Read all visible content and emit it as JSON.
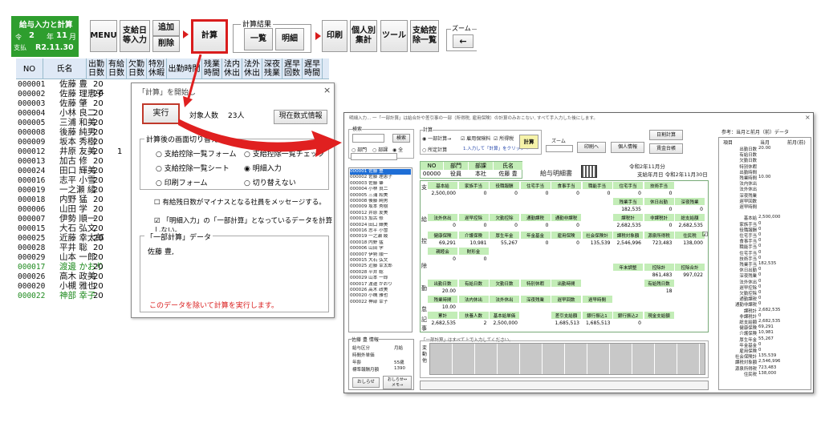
{
  "left_panel": {
    "title": "給与入力と計算",
    "era": "令",
    "year_num": "2",
    "year_label": "年",
    "month_num": "11",
    "month_label": "月",
    "pay_label": "支払",
    "pay_date": "R2.11.30"
  },
  "toolbar": {
    "menu": "MENU",
    "payday": "支給日\n等入力",
    "add": "追加",
    "delete": "削除",
    "calc": "計算",
    "result_group": "計算結果",
    "list": "一覧",
    "detail": "明細",
    "print": "印刷",
    "personal_total": "個人別\n集計",
    "tools": "ツール",
    "deduct_list": "支給控\n除一覧",
    "zoom": "ズーム",
    "zoom_arrow": "←"
  },
  "columns": [
    "NO",
    "氏名",
    "出勤\n日数",
    "有給\n日数",
    "欠勤\n日数",
    "特別\n休暇",
    "出勤時間",
    "残業\n時間",
    "法内\n休出",
    "法外\n休出",
    "深夜\n残業",
    "遅早\n回数",
    "遅早\n時間"
  ],
  "employees": [
    {
      "no": "000001",
      "name": "佐藤 豊",
      "days": "20",
      "paid": ""
    },
    {
      "no": "000002",
      "name": "佐藤 理恵子",
      "days": "20",
      "paid": ""
    },
    {
      "no": "000003",
      "name": "佐藤 肇",
      "days": "20",
      "paid": ""
    },
    {
      "no": "000004",
      "name": "小林 良二",
      "days": "20",
      "paid": ""
    },
    {
      "no": "000005",
      "name": "三浦 和美",
      "days": "20",
      "paid": ""
    },
    {
      "no": "000008",
      "name": "後藤 純男",
      "days": "20",
      "paid": ""
    },
    {
      "no": "000009",
      "name": "坂本 秀樹",
      "days": "20",
      "paid": ""
    },
    {
      "no": "000012",
      "name": "井原 友美",
      "days": "20",
      "paid": "1"
    },
    {
      "no": "000013",
      "name": "加古 修",
      "days": "20",
      "paid": ""
    },
    {
      "no": "000024",
      "name": "田口 輝美",
      "days": "20",
      "paid": ""
    },
    {
      "no": "000016",
      "name": "志平 小雪",
      "days": "20",
      "paid": ""
    },
    {
      "no": "000019",
      "name": "一之瀬 綾",
      "days": "20",
      "paid": ""
    },
    {
      "no": "000018",
      "name": "内野 猛",
      "days": "20",
      "paid": ""
    },
    {
      "no": "000006",
      "name": "山田 学",
      "days": "20",
      "paid": ""
    },
    {
      "no": "000007",
      "name": "伊勢 順一",
      "days": "20",
      "paid": ""
    },
    {
      "no": "000015",
      "name": "大石 弘文",
      "days": "20",
      "paid": ""
    },
    {
      "no": "000025",
      "name": "近藤 幸太郎",
      "days": "20",
      "paid": ""
    },
    {
      "no": "000028",
      "name": "平井 聡",
      "days": "20",
      "paid": ""
    },
    {
      "no": "000029",
      "name": "山本 一郎",
      "days": "20",
      "paid": ""
    },
    {
      "no": "000017",
      "name": "渡邊 かおり",
      "days": "20",
      "paid": ""
    },
    {
      "no": "000026",
      "name": "高木 政美",
      "days": "20",
      "paid": ""
    },
    {
      "no": "000020",
      "name": "小槻 雅也",
      "days": "20",
      "paid": ""
    },
    {
      "no": "000022",
      "name": "神部 幸子",
      "days": "20",
      "paid": ""
    }
  ],
  "calc_dialog": {
    "title": "「計算」を開始し",
    "close": "×",
    "run": "実行",
    "target_label": "対象人数",
    "target_count": "23人",
    "formula_info": "現在数式情報",
    "switch_group": "計算後の画面切り替え",
    "opt1": "支給控除一覧フォーム",
    "opt2": "支給控除一覧チェック",
    "opt3": "支給控除一覧シート",
    "opt4": "明細入力",
    "opt5": "印刷フォーム",
    "opt6": "切り替えない",
    "check1": "有給残日数がマイナスとなる社員をメッセージする。",
    "check2": "「明細入力」の「一部計算」となっているデータを計算しない。",
    "partial_group": "「一部計算」データ",
    "partial_name": "佐藤 豊,",
    "warning": "このデータを除いて計算を実行します。"
  },
  "detail_window": {
    "title": "明細入力... 一「一部計算」は給合計や差引事の一部（所得税, 雇用保険）の計算のみおこない, すべて手入力した後にします。",
    "search_group": "検索",
    "search_btn": "検索",
    "radio_dept": "部門",
    "radio_dept2": "部課",
    "radio_all": "全",
    "calc_group": "計算",
    "calc_partial": "一部計算→",
    "calc_emp": "雇用保険料",
    "calc_tax": "所得税",
    "calc_fixed": "所定計算",
    "calc_hint": "1.入力して「計算」をクリック→",
    "calc_btn": "計算",
    "zoom": "ズーム",
    "print": "印刷へ",
    "personal": "個人情報",
    "daily_calc": "日割計算",
    "wage_ledger": "賃金台帳",
    "header_no": "NO",
    "header_dept": "部門",
    "header_pos": "部課",
    "header_name": "氏名",
    "emp_no": "00000",
    "emp_pos": "役員",
    "emp_dept": "本社",
    "emp_name": "佐藤 豊",
    "slip": "給与明細書",
    "period": "令和2年11月分",
    "pay_date": "支給年月日 令和2年11月30日",
    "list": [
      "000001 佐藤 豊",
      "000002 佐藤 理恵子",
      "000003 佐藤 肇",
      "000004 小林 良二",
      "000005 三浦 和美",
      "000008 後藤 純男",
      "000009 坂本 秀樹",
      "000012 井原 友美",
      "000013 加古 修",
      "000024 田口 輝美",
      "000016 志平 小雪",
      "000019 一之瀬 綾",
      "000018 内野 猛",
      "000006 山田 学",
      "000007 伊勢 順一",
      "000015 大石 弘文",
      "000025 近藤 幸太郎",
      "000028 平井 聡",
      "000029 山本 一郎",
      "000017 渡邊 かおり",
      "000026 高木 政美",
      "000020 小槻 雅也",
      "000022 神部 幸子"
    ],
    "pay_h1": [
      "基本給",
      "家族手当",
      "役職報酬",
      "住宅手当",
      "食事手当",
      "職能手当",
      "住宅手当",
      "技術手当"
    ],
    "pay_v1": [
      "2,500,000",
      "0",
      "0",
      "0",
      "0",
      "0",
      "0",
      "0"
    ],
    "pay_h2": [
      "",
      "",
      "",
      "",
      "",
      "",
      "残業手当",
      "休日出勤",
      "深夜残業"
    ],
    "pay_v2": [
      "",
      "",
      "",
      "",
      "",
      "",
      "182,535",
      "0",
      "0"
    ],
    "pay_h3": [
      "法外休出",
      "遅早控除",
      "欠勤控除",
      "通勤課税",
      "通勤非課税",
      "",
      "課税計",
      "非課税計",
      "総支給額"
    ],
    "pay_v3": [
      "0",
      "0",
      "0",
      "0",
      "0",
      "",
      "2,682,535",
      "0",
      "2,682,535"
    ],
    "ded_h1": [
      "健康保険",
      "介護保険",
      "厚生年金",
      "年金基金",
      "雇用保険",
      "社会保険計",
      "課税対象額",
      "源泉所得税",
      "住民税"
    ],
    "ded_v1": [
      "69,291",
      "10,981",
      "55,267",
      "0",
      "0",
      "135,539",
      "2,546,996",
      "723,483",
      "138,000"
    ],
    "ded_h2": [
      "親睦会",
      "財形金"
    ],
    "ded_v2": [
      "0",
      "0"
    ],
    "ded_h3": [
      "年末調整",
      "控除計",
      "控除合計"
    ],
    "ded_v3": [
      "",
      "861,483",
      "997,022"
    ],
    "att_h1": [
      "出勤日数",
      "有給日数",
      "欠勤日数",
      "特別休暇",
      "出勤時間",
      "",
      "",
      "有給残日数"
    ],
    "att_v1": [
      "20.00",
      "",
      "",
      "",
      "",
      "",
      "",
      "18"
    ],
    "att_h2": [
      "残業時間",
      "法内休出",
      "法外休出",
      "深夜残業",
      "遅早回数",
      "遅早時間"
    ],
    "att_v2": [
      "10.00"
    ],
    "sum_h": [
      "累計",
      "扶養人数",
      "基本給単価",
      "",
      "差引支給額",
      "銀行振込1",
      "銀行振込2",
      "現金支給額"
    ],
    "sum_v": [
      "2,682,535",
      "2",
      "2,500,000",
      "",
      "1,685,513",
      "1,685,513",
      "0",
      ""
    ],
    "side_pay": "支",
    "side_pay2": "給",
    "side_ded": "控",
    "side_ded2": "除",
    "side_att": "勤",
    "side_att2": "怠",
    "side_rec": "記",
    "side_rec2": "事",
    "emp_info_title": "佐藤 豊 情報",
    "emp_info": [
      [
        "給与区分",
        "月給"
      ],
      [
        "時間外単価",
        ""
      ],
      [
        "年齢",
        "55歳"
      ],
      [
        "標準報酬月額",
        "1390"
      ]
    ],
    "close_btn": "おしらせ",
    "memo_btn": "おしらせ↔\nメモ→",
    "partial_note": "「一部計算」はすべて上で入力してください。",
    "change_label": "変\n動\n他",
    "ref_title": "参考：当月と前月（前）データ",
    "ref_head": [
      "項目",
      "当月",
      "前月(前)"
    ],
    "ref_rows": [
      [
        "出勤日数",
        "20.00"
      ],
      [
        "有給日数",
        ""
      ],
      [
        "欠勤日数",
        ""
      ],
      [
        "特別休暇",
        ""
      ],
      [
        "出勤時間",
        ""
      ],
      [
        "残業時間",
        "10.00"
      ],
      [
        "法内休出",
        ""
      ],
      [
        "法外休出",
        ""
      ],
      [
        "深夜残業",
        ""
      ],
      [
        "遅早回数",
        ""
      ],
      [
        "遅早時間",
        ""
      ],
      [
        "",
        ""
      ],
      [
        "基本給",
        "2,500,000"
      ],
      [
        "家族手当",
        "0"
      ],
      [
        "役職報酬",
        "0"
      ],
      [
        "住宅手当",
        "0"
      ],
      [
        "食事手当",
        "0"
      ],
      [
        "職能手当",
        "0"
      ],
      [
        "住宅手当",
        "0"
      ],
      [
        "技術手当",
        "0"
      ],
      [
        "残業手当",
        "182,535"
      ],
      [
        "休日出勤",
        "0"
      ],
      [
        "深夜残業",
        "0"
      ],
      [
        "法外休出",
        "0"
      ],
      [
        "遅早控除",
        "0"
      ],
      [
        "欠勤控除",
        "0"
      ],
      [
        "通勤課税",
        "0"
      ],
      [
        "通勤非課税",
        "0"
      ],
      [
        "課税計",
        "2,682,535"
      ],
      [
        "非課税計",
        "0"
      ],
      [
        "総支給額",
        "2,682,535"
      ],
      [
        "健康保険",
        "69,291"
      ],
      [
        "介護保険",
        "10,981"
      ],
      [
        "厚生年金",
        "55,267"
      ],
      [
        "年金基金",
        "0"
      ],
      [
        "雇用保険",
        "0"
      ],
      [
        "社会保険計",
        "135,539"
      ],
      [
        "課税対象額",
        "2,546,996"
      ],
      [
        "源泉所得税",
        "723,483"
      ],
      [
        "住民税",
        "138,000"
      ]
    ]
  },
  "colors": {
    "green_panel": "#2e9e2e",
    "red": "#d91c1c",
    "grid_header": "#dfe9f6",
    "table_green": "#c3edb7"
  }
}
